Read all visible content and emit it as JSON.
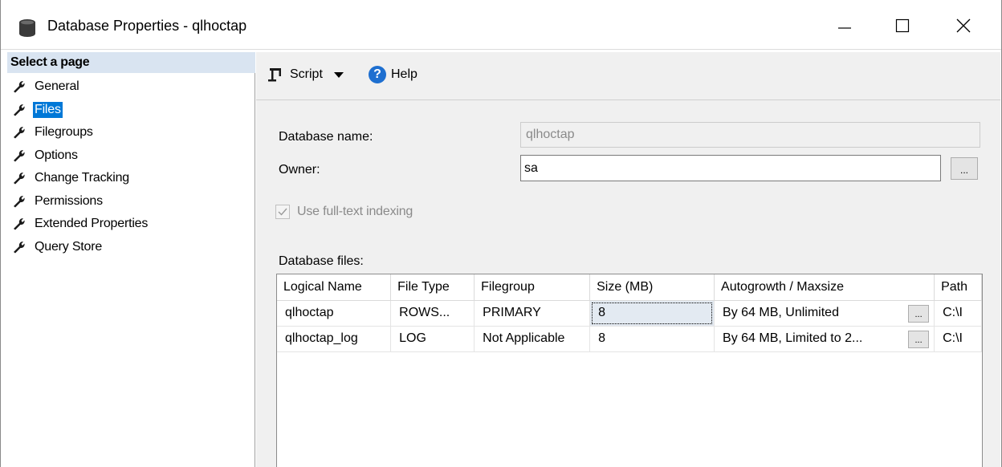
{
  "window": {
    "title": "Database Properties - qlhoctap"
  },
  "left_panel": {
    "header": "Select a page",
    "items": [
      {
        "label": "General",
        "selected": false
      },
      {
        "label": "Files",
        "selected": true
      },
      {
        "label": "Filegroups",
        "selected": false
      },
      {
        "label": "Options",
        "selected": false
      },
      {
        "label": "Change Tracking",
        "selected": false
      },
      {
        "label": "Permissions",
        "selected": false
      },
      {
        "label": "Extended Properties",
        "selected": false
      },
      {
        "label": "Query Store",
        "selected": false
      }
    ]
  },
  "toolbar": {
    "script_label": "Script",
    "help_label": "Help"
  },
  "form": {
    "database_name_label": "Database name:",
    "database_name_value": "qlhoctap",
    "owner_label": "Owner:",
    "owner_value": "sa",
    "owner_browse_label": "...",
    "fulltext_label": "Use full-text indexing",
    "fulltext_checked": true,
    "database_files_label": "Database files:"
  },
  "files_grid": {
    "columns": [
      "Logical Name",
      "File Type",
      "Filegroup",
      "Size (MB)",
      "Autogrowth / Maxsize",
      "Path"
    ],
    "rows": [
      {
        "logical_name": "qlhoctap",
        "file_type": "ROWS...",
        "filegroup": "PRIMARY",
        "size": "8",
        "autogrowth": "By 64 MB, Unlimited",
        "browse": "...",
        "path": "C:\\I"
      },
      {
        "logical_name": "qlhoctap_log",
        "file_type": "LOG",
        "filegroup": "Not Applicable",
        "size": "8",
        "autogrowth": "By 64 MB, Limited to 2...",
        "browse": "...",
        "path": "C:\\I"
      }
    ]
  },
  "colors": {
    "selection": "#0078d7",
    "header_bg": "#d9e4f1",
    "panel_bg": "#f0f0f0",
    "help_icon": "#1e6fd0"
  }
}
